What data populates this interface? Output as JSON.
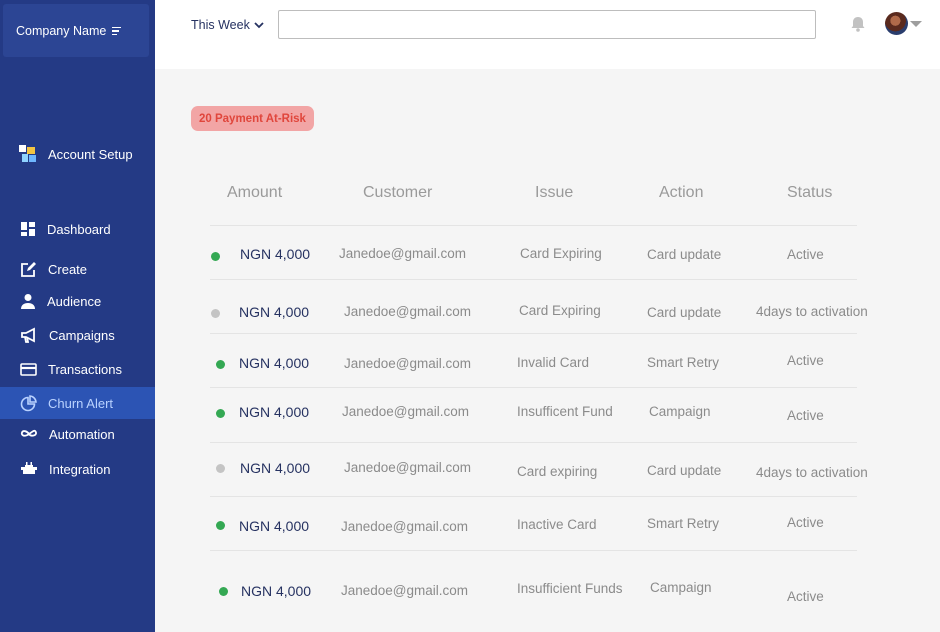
{
  "company": {
    "name": "Company Name"
  },
  "sidebar": {
    "setup_label": "Account Setup",
    "items": [
      {
        "label": "Dashboard",
        "icon": "dashboard-icon"
      },
      {
        "label": "Create",
        "icon": "edit-icon"
      },
      {
        "label": "Audience",
        "icon": "user-icon"
      },
      {
        "label": "Campaigns",
        "icon": "megaphone-icon"
      },
      {
        "label": "Transactions",
        "icon": "card-icon"
      },
      {
        "label": "Churn Alert",
        "icon": "pie-chart-icon",
        "active": true
      },
      {
        "label": "Automation",
        "icon": "infinity-icon"
      },
      {
        "label": "Integration",
        "icon": "plug-icon"
      }
    ]
  },
  "topbar": {
    "period": "This Week",
    "search_value": ""
  },
  "badge": "20 Payment At-Risk",
  "table": {
    "headers": [
      "Amount",
      "Customer",
      "Issue",
      "Action",
      "Status"
    ],
    "rows": [
      {
        "amount": "NGN 4,000",
        "customer": "Janedoe@gmail.com",
        "issue": "Card Expiring",
        "action": "Card update",
        "status": "Active",
        "dot": "green"
      },
      {
        "amount": "NGN 4,000",
        "customer": "Janedoe@gmail.com",
        "issue": "Card Expiring",
        "action": "Card update",
        "status": "4days to activation",
        "dot": "grey"
      },
      {
        "amount": "NGN 4,000",
        "customer": "Janedoe@gmail.com",
        "issue": "Invalid Card",
        "action": "Smart Retry",
        "status": "Active",
        "dot": "green"
      },
      {
        "amount": "NGN 4,000",
        "customer": "Janedoe@gmail.com",
        "issue": "Insufficent Fund",
        "action": "Campaign",
        "status": "Active",
        "dot": "green"
      },
      {
        "amount": "NGN 4,000",
        "customer": "Janedoe@gmail.com",
        "issue": "Card expiring",
        "action": "Card update",
        "status": "4days to activation",
        "dot": "grey"
      },
      {
        "amount": "NGN 4,000",
        "customer": "Janedoe@gmail.com",
        "issue": "Inactive Card",
        "action": "Smart Retry",
        "status": "Active",
        "dot": "green"
      },
      {
        "amount": "NGN 4,000",
        "customer": "Janedoe@gmail.com",
        "issue": "Insufficient Funds",
        "action": "Campaign",
        "status": "Active",
        "dot": "green"
      }
    ]
  },
  "colors": {
    "sidebar": "#243a85",
    "active_item": "#2c54b4",
    "status_green": "#34a853",
    "status_grey": "#c4c4c4",
    "badge_bg": "#f2a5a5",
    "badge_text": "#e0463c"
  }
}
